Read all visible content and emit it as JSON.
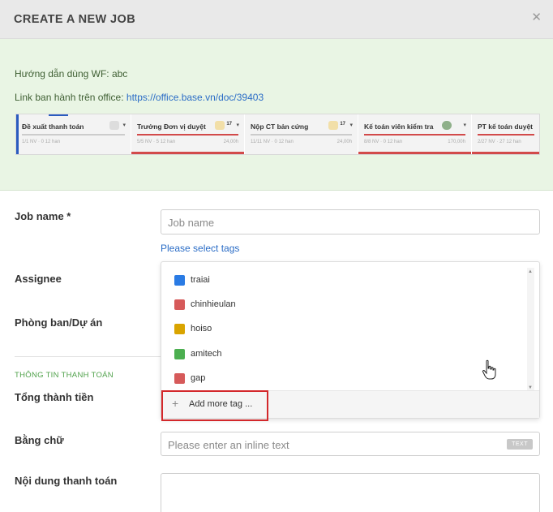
{
  "modal": {
    "title": "CREATE A NEW JOB",
    "close_icon": "close-icon"
  },
  "guide": {
    "line1": "Hướng dẫn dùng WF: abc",
    "line2_prefix": "Link ban hành trên office: ",
    "line2_link": "https://office.base.vn/doc/39403"
  },
  "workflow": {
    "stages": [
      {
        "name": "Đề xuất thanh toán",
        "meta": "1/1 NV · 0 12 han",
        "time": "",
        "count": "",
        "status": "active"
      },
      {
        "name": "Trưởng Đơn vị duyệt",
        "meta": "5/5 NV · 5 12 han",
        "time": "24,00h",
        "count": "17",
        "status": "overdue"
      },
      {
        "name": "Nộp CT bản cứng",
        "meta": "11/11 NV · 0 12 han",
        "time": "24,00h",
        "count": "17",
        "status": "normal"
      },
      {
        "name": "Kế toán viên kiểm tra",
        "meta": "8/8 NV · 0 12 han",
        "time": "170,00h",
        "count": "",
        "status": "overdue"
      },
      {
        "name": "PT kế toán duyệt",
        "meta": "2/27 NV · 27 12 han",
        "time": "",
        "count": "",
        "status": "overdue"
      }
    ]
  },
  "form": {
    "job_name_label": "Job name *",
    "job_name_placeholder": "Job name",
    "select_tags_link": "Please select tags",
    "assignee_label": "Assignee",
    "department_label": "Phòng ban/Dự án",
    "section_payment": "THÔNG TIN THANH TOÁN",
    "total_label": "Tổng thành tiền",
    "in_words_label": "Bằng chữ",
    "in_words_placeholder": "Please enter an inline text",
    "in_words_badge": "TEXT",
    "content_label": "Nội dung thanh toán"
  },
  "tags_dropdown": {
    "options": [
      {
        "label": "traiai",
        "color": "#2a7be4"
      },
      {
        "label": "chinhieulan",
        "color": "#d65a5a"
      },
      {
        "label": "hoiso",
        "color": "#d9a400"
      },
      {
        "label": "amitech",
        "color": "#4caf50"
      },
      {
        "label": "gap",
        "color": "#d65a5a"
      }
    ],
    "add_more_label": "Add more tag ..."
  },
  "colors": {
    "accent": "#2a6cc6",
    "highlight": "#d3282b",
    "section": "#4fa14a",
    "guide_bg": "#e9f5e4"
  }
}
